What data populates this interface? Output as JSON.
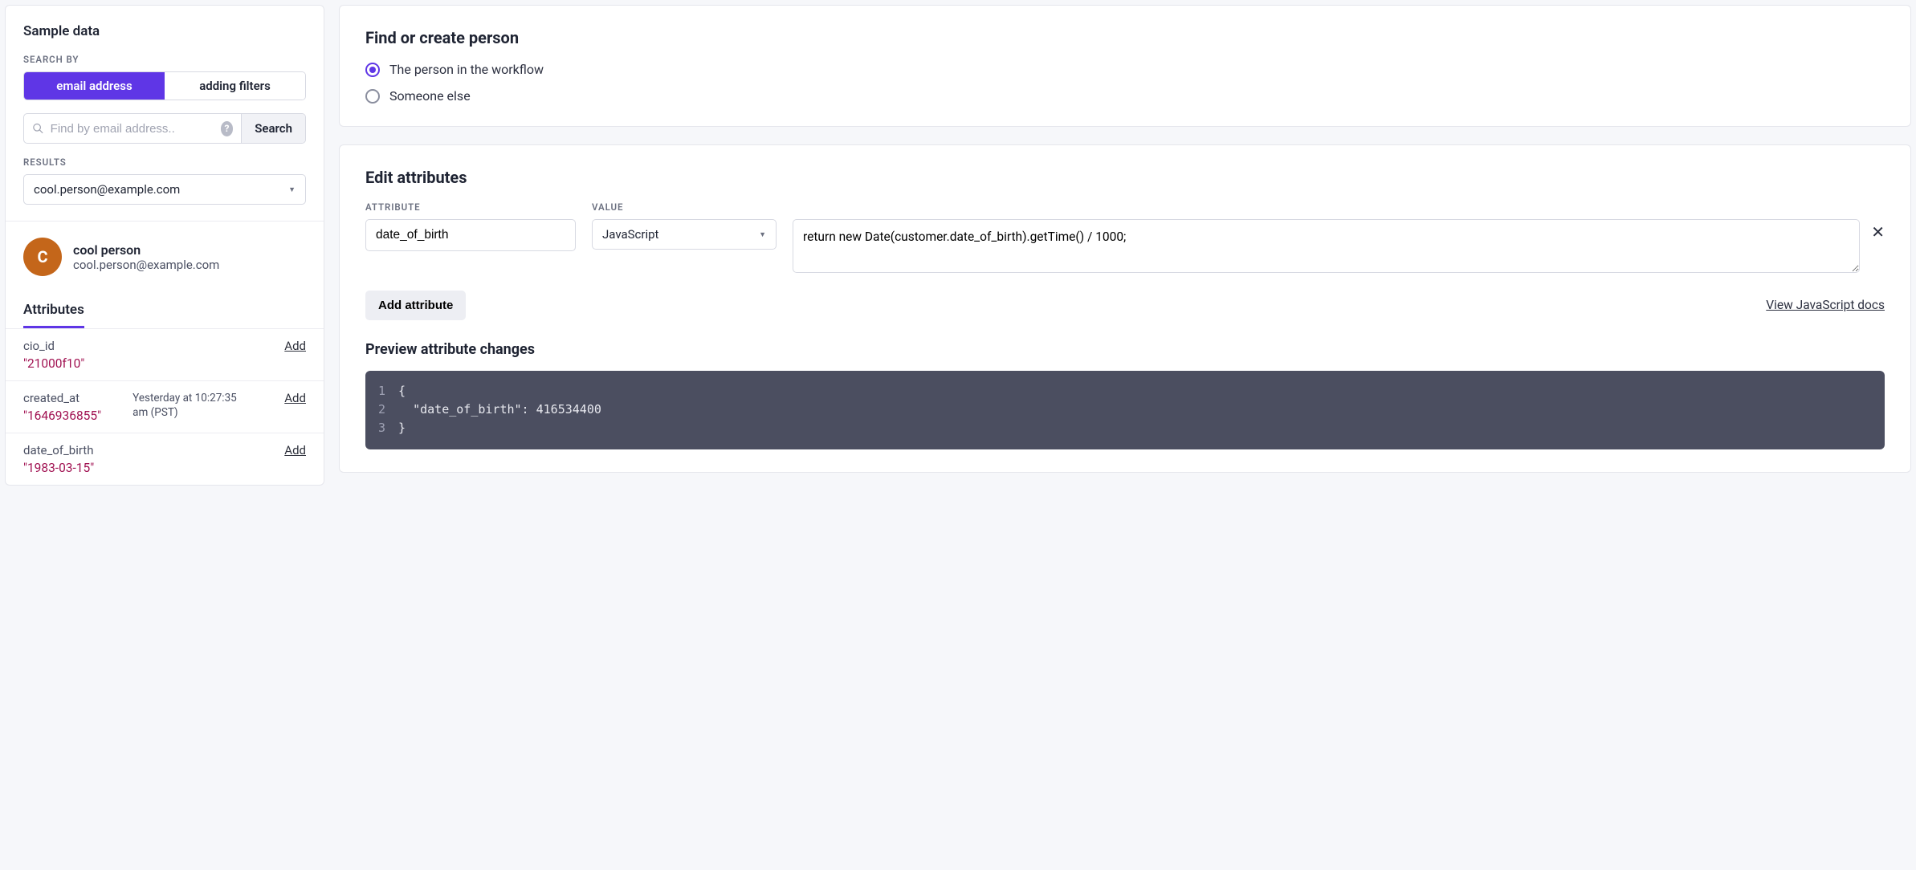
{
  "sidebar": {
    "title": "Sample data",
    "search_by_label": "SEARCH BY",
    "tabs": {
      "email": "email address",
      "filters": "adding filters"
    },
    "search": {
      "placeholder": "Find by email address..",
      "button": "Search"
    },
    "results_label": "RESULTS",
    "results_selected": "cool.person@example.com",
    "person": {
      "initial": "C",
      "name": "cool person",
      "email": "cool.person@example.com"
    },
    "attributes_tab": "Attributes",
    "add_label": "Add",
    "attrs": [
      {
        "key": "cio_id",
        "value": "\"21000f10\"",
        "meta": ""
      },
      {
        "key": "created_at",
        "value": "\"1646936855\"",
        "meta": "Yesterday at 10:27:35 am (PST)"
      },
      {
        "key": "date_of_birth",
        "value": "\"1983-03-15\"",
        "meta": ""
      }
    ]
  },
  "find": {
    "title": "Find or create person",
    "opt_workflow": "The person in the workflow",
    "opt_else": "Someone else"
  },
  "edit": {
    "title": "Edit attributes",
    "header_attr": "ATTRIBUTE",
    "header_val": "VALUE",
    "attr_value": "date_of_birth",
    "value_type": "JavaScript",
    "code": "return new Date(customer.date_of_birth).getTime() / 1000;",
    "add_button": "Add attribute",
    "docs_link": "View JavaScript docs"
  },
  "preview": {
    "title": "Preview attribute changes",
    "lines": [
      "{",
      "  \"date_of_birth\": 416534400",
      "}"
    ]
  }
}
